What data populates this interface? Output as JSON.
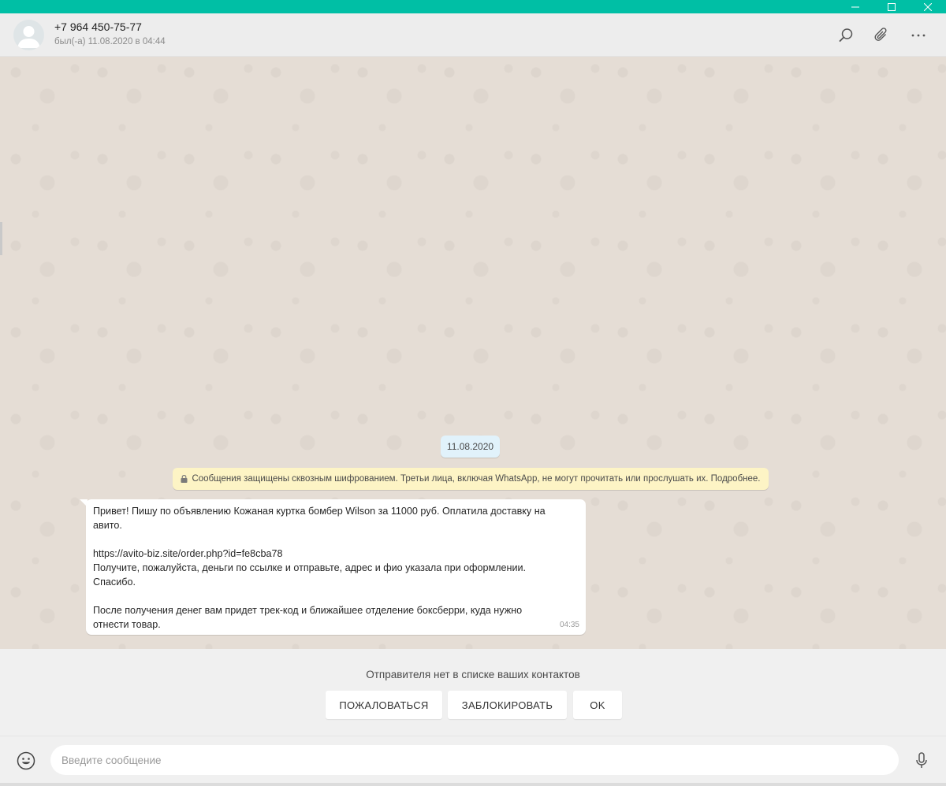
{
  "contact": {
    "name": "+7 964 450-75-77",
    "status": "был(-а) 11.08.2020 в 04:44"
  },
  "header_icons": [
    "search-icon",
    "attach-icon",
    "menu-icon"
  ],
  "window_controls": [
    "minimize-icon",
    "maximize-icon",
    "close-icon"
  ],
  "chat": {
    "date_label": "11.08.2020",
    "encryption_notice": "Сообщения защищены сквозным шифрованием. Третьи лица, включая WhatsApp, не могут прочитать или прослушать их. Подробнее.",
    "message": {
      "line1": "Привет! Пишу по объявлению Кожаная куртка бомбер Wilson за 11000 руб. Оплатила доставку на",
      "line2": "авито.",
      "line3": "https://avito-biz.site/order.php?id=fe8cba78",
      "line4": "Получите, пожалуйста, деньги по ссылке и отправьте, адрес и фио указала при оформлении.",
      "line5": "Спасибо.",
      "line6": "После получения денег вам придет трек-код и ближайшее отделение боксберри, куда нужно",
      "line7": "отнести товар.",
      "time": "04:35"
    }
  },
  "unknown_sender": {
    "notice": "Отправителя нет в списке ваших контактов",
    "report_label": "ПОЖАЛОВАТЬСЯ",
    "block_label": "ЗАБЛОКИРОВАТЬ",
    "ok_label": "OK"
  },
  "composer": {
    "placeholder": "Введите сообщение"
  },
  "colors": {
    "title_bar": "#00bfa5",
    "chat_background": "#e5ddd5",
    "date_pill": "#e1f2fb",
    "encryption_notice": "#fdf4c5",
    "incoming_bubble": "#ffffff"
  }
}
